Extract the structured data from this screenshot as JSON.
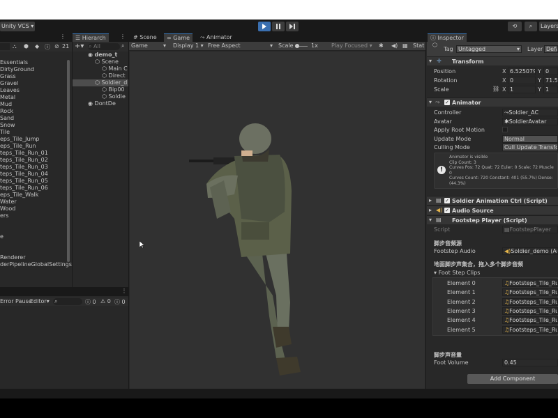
{
  "toolbar": {
    "vcs_label": "Unity VCS",
    "layers_label": "Layers",
    "play_icon": "play-icon",
    "pause_icon": "pause-icon",
    "step_icon": "step-icon"
  },
  "project": {
    "count": "21",
    "items": [
      "Essentials",
      "DirtyGround",
      "Grass",
      "Gravel",
      "Leaves",
      "Metal",
      "Mud",
      "Rock",
      "Sand",
      "Snow",
      "Tile",
      "eps_Tile_Jump",
      "eps_Tile_Run",
      "teps_Tile_Run_01",
      "teps_Tile_Run_02",
      "teps_Tile_Run_03",
      "teps_Tile_Run_04",
      "teps_Tile_Run_05",
      "teps_Tile_Run_06",
      "eps_Tile_Walk",
      "Water",
      "Wood",
      "ers",
      "",
      "",
      "e",
      "",
      "",
      "Renderer",
      "derPipelineGlobalSettings"
    ]
  },
  "hierarchy": {
    "tab": "Hierarch",
    "search_placeholder": "All",
    "items": [
      {
        "label": "demo_t",
        "indent": 0,
        "bold": true
      },
      {
        "label": "Scene",
        "indent": 1
      },
      {
        "label": "Main C",
        "indent": 2
      },
      {
        "label": "Direct",
        "indent": 2
      },
      {
        "label": "Soldier_d",
        "indent": 1,
        "selected": true
      },
      {
        "label": "Bip00",
        "indent": 2
      },
      {
        "label": "Soldie",
        "indent": 2
      },
      {
        "label": "DontDe",
        "indent": 0
      }
    ]
  },
  "console": {
    "error_pause": "Error Pause",
    "editor": "Editor",
    "count_msgs": "0",
    "count_warn": "0",
    "count_err": "0"
  },
  "view": {
    "tabs": [
      "Scene",
      "Game",
      "Animator"
    ],
    "game_dropdown": "Game",
    "display": "Display 1",
    "aspect": "Free Aspect",
    "scale_label": "Scale",
    "scale_value": "1x",
    "play_focused": "Play Focused",
    "stats": "Stat"
  },
  "inspector": {
    "tab": "Inspector",
    "tag_label": "Tag",
    "tag_value": "Untagged",
    "layer_label": "Layer",
    "layer_value": "Defau",
    "transform": {
      "title": "Transform",
      "position_label": "Position",
      "rotation_label": "Rotation",
      "scale_label": "Scale",
      "pos_x": "6.525079",
      "pos_y": "0",
      "rot_x": "0",
      "rot_y": "71.58",
      "scale_x": "1",
      "scale_y": "1"
    },
    "animator": {
      "title": "Animator",
      "controller_label": "Controller",
      "controller_value": "Soldier_AC",
      "avatar_label": "Avatar",
      "avatar_value": "SoldierAvatar",
      "apply_root_label": "Apply Root Motion",
      "update_mode_label": "Update Mode",
      "update_mode_value": "Normal",
      "culling_label": "Culling Mode",
      "culling_value": "Cull Update Transform",
      "info_lines": [
        "Animator is visible",
        "Clip Count: 3",
        "Curves Pos: 72 Quat: 72 Euler: 0 Scale: 72 Muscle",
        "0",
        "Curves Count: 720 Constant: 401 (55.7%) Dense:",
        "(44.3%)"
      ]
    },
    "soldier_ctrl_title": "Soldier Animation Ctrl (Script)",
    "audio_source_title": "Audio Source",
    "footstep": {
      "title": "Footstep Player (Script)",
      "script_label": "Script",
      "script_value": "FootstepPlayer",
      "header_source": "脚步音频源",
      "footstep_audio_label": "Footstep Audio",
      "footstep_audio_value": "Soldier_demo (Audi",
      "header_clips": "地面脚步声集合，拖入多个脚步音频",
      "clips_label": "Foot Step Clips",
      "elements": [
        {
          "label": "Element 0",
          "value": "Footsteps_Tile_Run_"
        },
        {
          "label": "Element 1",
          "value": "Footsteps_Tile_Run_"
        },
        {
          "label": "Element 2",
          "value": "Footsteps_Tile_Run_"
        },
        {
          "label": "Element 3",
          "value": "Footsteps_Tile_Run_"
        },
        {
          "label": "Element 4",
          "value": "Footsteps_Tile_Run_"
        },
        {
          "label": "Element 5",
          "value": "Footsteps_Tile_Run_"
        }
      ],
      "header_volume": "脚步声音量",
      "volume_label": "Foot Volume",
      "volume_value": "0.45"
    },
    "add_component": "Add Component"
  }
}
